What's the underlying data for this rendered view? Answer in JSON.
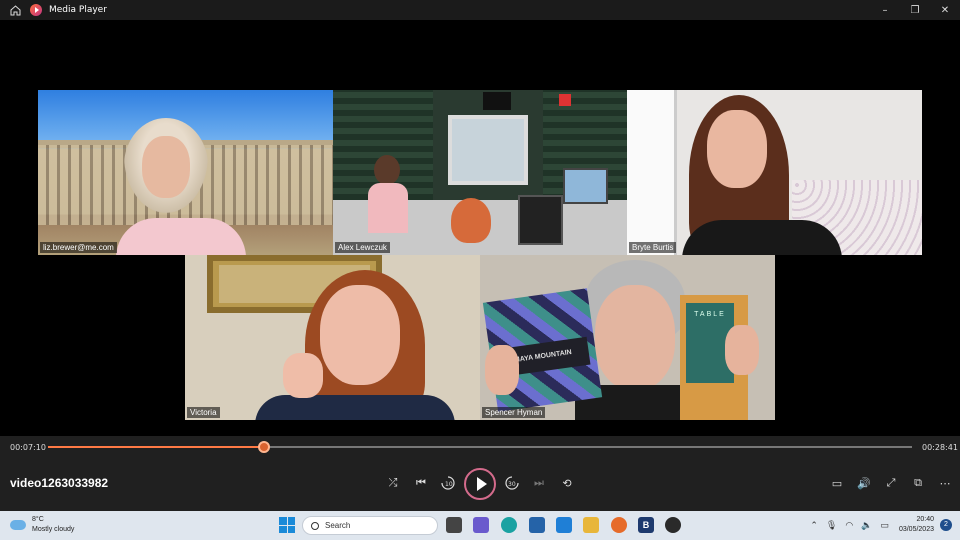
{
  "window": {
    "title": "Media Player",
    "minimize": "–",
    "maximize": "❐",
    "close": "✕"
  },
  "participants": [
    {
      "name": "liz.brewer@me.com"
    },
    {
      "name": "Alex Lewczuk"
    },
    {
      "name": "Bryte Burtis"
    },
    {
      "name": "Victoria"
    },
    {
      "name": "Spencer Hyman"
    }
  ],
  "props": {
    "book1_label": "MAYA MOUNTAIN",
    "book2_label": "TABLE"
  },
  "player": {
    "elapsed": "00:07:10",
    "duration": "00:28:41",
    "progress_fraction": 0.25,
    "video_title": "video1263033982",
    "icons": {
      "shuffle": "⤮",
      "previous": "⏮",
      "rewind": "↺",
      "play": "play",
      "forward": "↻",
      "next": "⏭",
      "repeat": "⟲",
      "captions": "▭",
      "volume": "🔊",
      "fullscreen": "⤢",
      "miniplayer": "⧉",
      "more": "⋯"
    },
    "rewind_label": "10",
    "forward_label": "30"
  },
  "taskbar": {
    "temperature": "8°C",
    "weather": "Mostly cloudy",
    "search_placeholder": "Search",
    "time": "20:40",
    "date": "03/05/2023",
    "notification_count": "2",
    "accent": "#1a8ad8"
  }
}
